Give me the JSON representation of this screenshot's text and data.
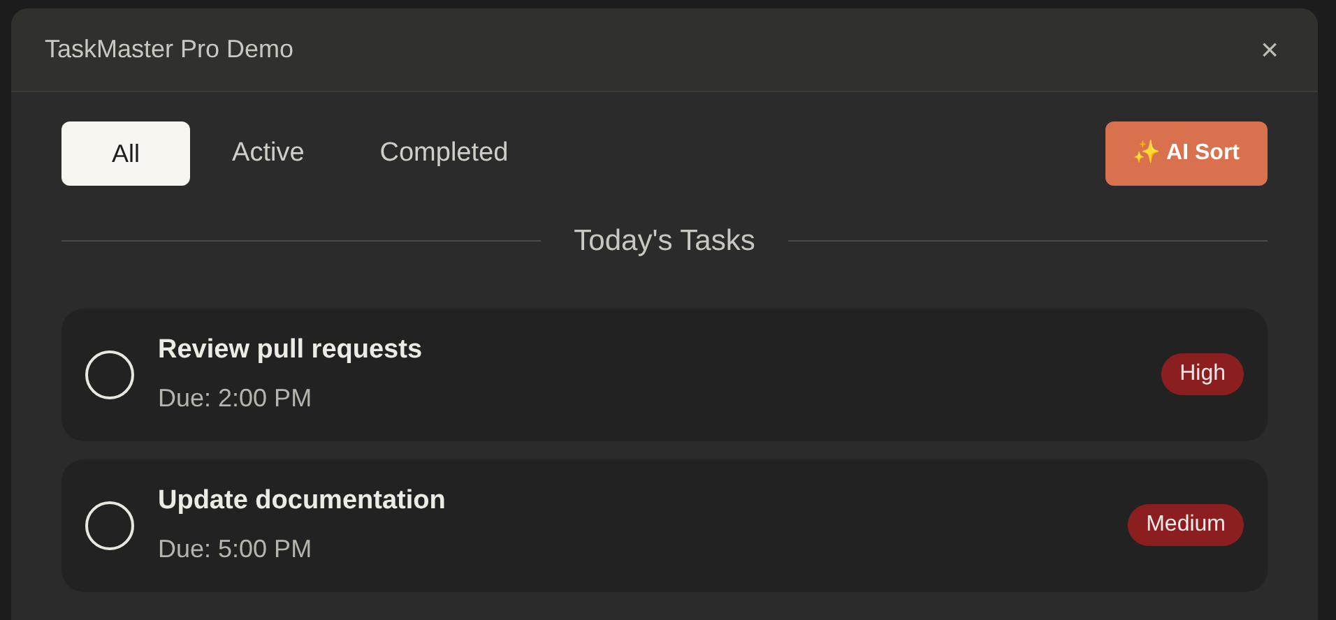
{
  "window": {
    "title": "TaskMaster Pro Demo",
    "close": "×"
  },
  "tabs": [
    {
      "label": "All",
      "selected": true
    },
    {
      "label": "Active",
      "selected": false
    },
    {
      "label": "Completed",
      "selected": false
    }
  ],
  "sort_button": {
    "icon": "✨",
    "label": "AI Sort"
  },
  "section_title": "Today's Tasks",
  "tasks": [
    {
      "title": "Review pull requests",
      "due": "Due: 2:00 PM",
      "checked": false,
      "priority": "High",
      "color": "#8b1f1f"
    },
    {
      "title": "Update documentation",
      "due": "Due: 5:00 PM",
      "checked": false,
      "priority": "Medium",
      "color": "#8b1f1f"
    }
  ]
}
